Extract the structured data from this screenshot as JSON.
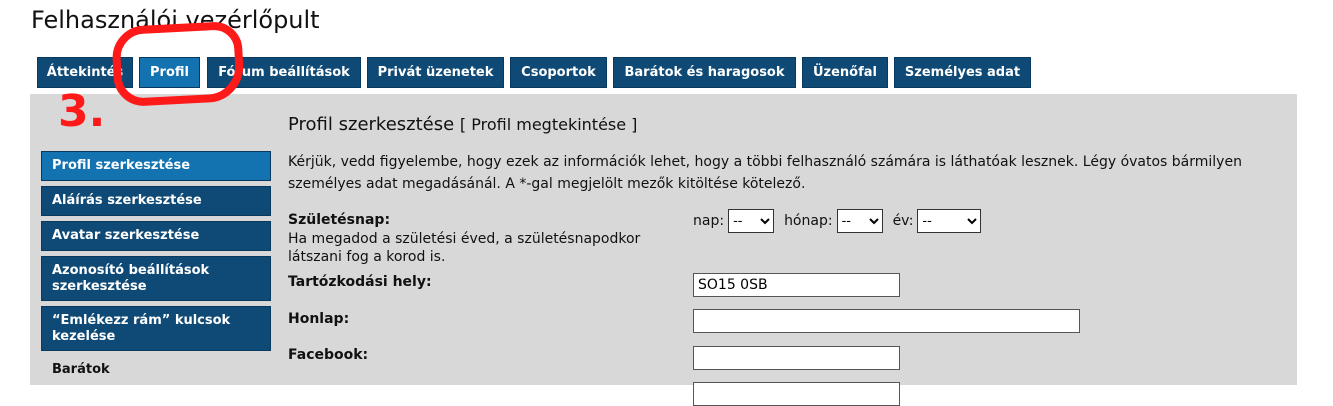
{
  "page": {
    "title": "Felhasználói vezérlőpult"
  },
  "tabs": [
    {
      "label": "Áttekintés"
    },
    {
      "label": "Profil"
    },
    {
      "label": "Fórum beállítások"
    },
    {
      "label": "Privát üzenetek"
    },
    {
      "label": "Csoportok"
    },
    {
      "label": "Barátok és haragosok"
    },
    {
      "label": "Üzenőfal"
    },
    {
      "label": "Személyes adat"
    }
  ],
  "annotation": {
    "number": "3."
  },
  "sidebar": {
    "items": [
      {
        "label": "Profil szerkesztése"
      },
      {
        "label": "Aláírás szerkesztése"
      },
      {
        "label": "Avatar szerkesztése"
      },
      {
        "label": "Azonosító beállítások szerkesztése"
      },
      {
        "label": "“Emlékezz rám” kulcsok kezelése"
      }
    ],
    "plain_item": "Barátok"
  },
  "main": {
    "title": "Profil szerkesztése",
    "view_link": "[ Profil megtekintése ]",
    "intro": "Kérjük, vedd figyelembe, hogy ezek az információk lehet, hogy a többi felhasználó számára is láthatóak lesznek. Légy óvatos bármilyen személyes adat megadásánál. A *-gal megjelölt mezők kitöltése kötelező.",
    "birthday": {
      "label": "Születésnap:",
      "help": "Ha megadod a születési éved, a születésnapodkor látszani fog a korod is.",
      "day_label": "nap:",
      "day_value": "--",
      "month_label": "hónap:",
      "month_value": "--",
      "year_label": "év:",
      "year_value": "--"
    },
    "location": {
      "label": "Tartózkodási hely:",
      "value": "SO15 0SB"
    },
    "homepage": {
      "label": "Honlap:",
      "value": ""
    },
    "facebook": {
      "label": "Facebook:",
      "value": ""
    }
  }
}
